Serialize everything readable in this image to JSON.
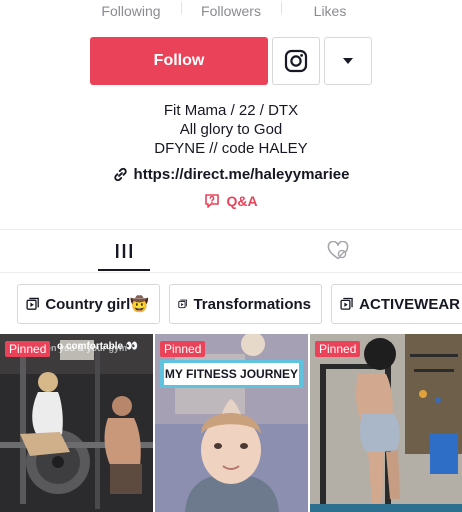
{
  "profile": {
    "stats": {
      "following_label": "Following",
      "followers_label": "Followers",
      "likes_label": "Likes"
    },
    "follow_label": "Follow",
    "bio_lines": [
      "Fit Mama / 22 / DTX",
      "All glory to God",
      "DFYNE // code HALEY"
    ],
    "link_text": "https://direct.me/haleyymariee",
    "qa_label": "Q&A"
  },
  "tabs": [
    {
      "icon": "videos-grid-icon",
      "active": true
    },
    {
      "icon": "liked-heart-icon",
      "active": false
    }
  ],
  "playlists": [
    {
      "label": "Country girl🤠"
    },
    {
      "label": "Transformations"
    },
    {
      "label": "ACTIVEWEAR"
    }
  ],
  "videos": [
    {
      "badge": "Pinned",
      "overlay_text": "o comfortable 👀"
    },
    {
      "badge": "Pinned",
      "overlay_text": "MY FITNESS JOURNEY"
    },
    {
      "badge": "Pinned",
      "overlay_text": ""
    }
  ],
  "colors": {
    "accent": "#ea4359",
    "text": "#161823",
    "muted": "#8a8b91",
    "border": "#d7d7d9"
  }
}
